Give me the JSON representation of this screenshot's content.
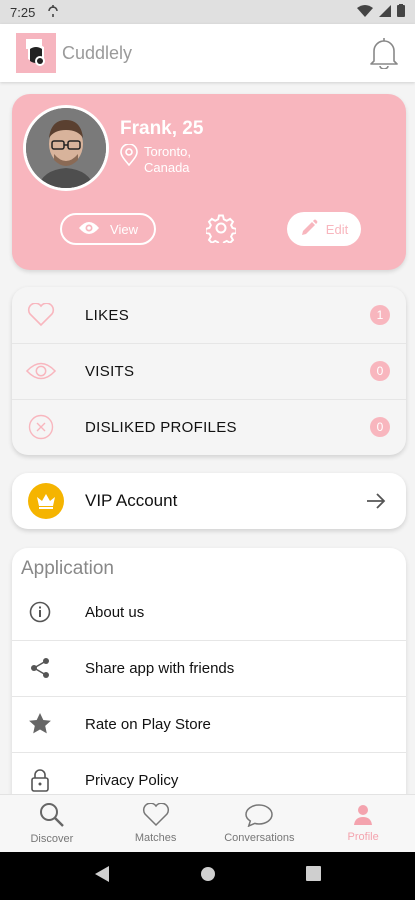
{
  "statusbar": {
    "time": "7:25"
  },
  "appbar": {
    "title": "Cuddlely"
  },
  "profile": {
    "name": "Frank, 25",
    "location": "Toronto, Canada",
    "view_label": "View",
    "edit_label": "Edit"
  },
  "stats": [
    {
      "label": "LIKES",
      "count": "1"
    },
    {
      "label": "VISITS",
      "count": "0"
    },
    {
      "label": "DISLIKED PROFILES",
      "count": "0"
    }
  ],
  "vip": {
    "label": "VIP Account"
  },
  "application": {
    "heading": "Application",
    "items": [
      {
        "label": "About us",
        "icon": "info-icon"
      },
      {
        "label": "Share app with friends",
        "icon": "share-icon"
      },
      {
        "label": "Rate on Play Store",
        "icon": "star-icon"
      },
      {
        "label": "Privacy Policy",
        "icon": "lock-icon"
      }
    ]
  },
  "bottom_nav": [
    {
      "label": "Discover",
      "icon": "search-icon"
    },
    {
      "label": "Matches",
      "icon": "heart-icon"
    },
    {
      "label": "Conversations",
      "icon": "chat-icon"
    },
    {
      "label": "Profile",
      "icon": "person-icon",
      "active": true
    }
  ],
  "colors": {
    "accent": "#f8b6be",
    "vip": "#f5b400"
  }
}
